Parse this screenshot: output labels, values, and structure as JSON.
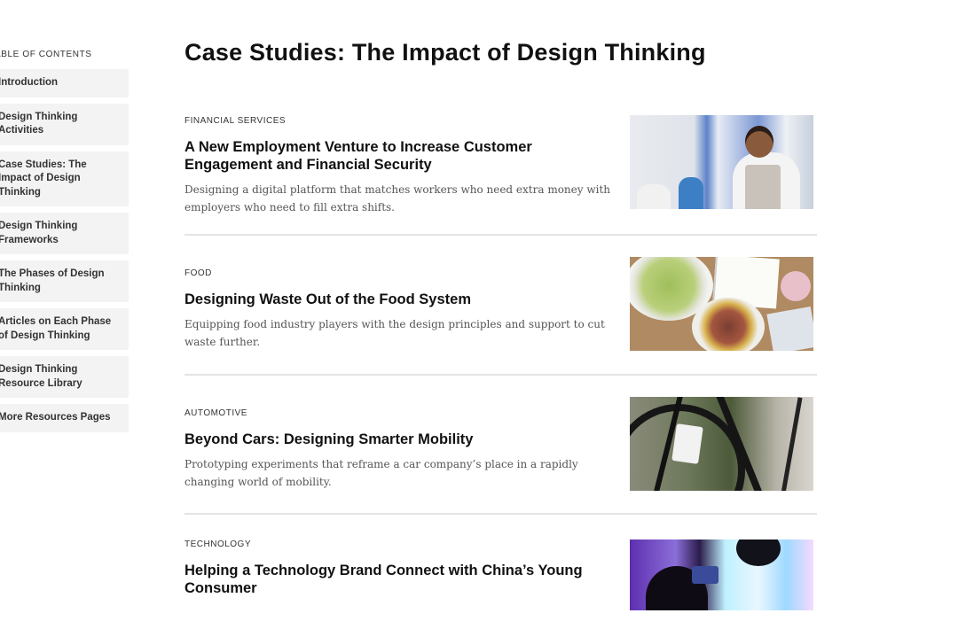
{
  "toc": {
    "heading": "TABLE OF CONTENTS",
    "items": [
      {
        "label": "Introduction"
      },
      {
        "label": "Design Thinking Activities"
      },
      {
        "label": "Case Studies: The Impact of Design Thinking"
      },
      {
        "label": "Design Thinking Frameworks"
      },
      {
        "label": "The Phases of Design Thinking"
      },
      {
        "label": "Articles on Each Phase of Design Thinking"
      },
      {
        "label": "Design Thinking Resource Library"
      },
      {
        "label": "More Resources Pages"
      }
    ]
  },
  "page": {
    "title": "Case Studies: The Impact of Design Thinking"
  },
  "cases": [
    {
      "category": "FINANCIAL SERVICES",
      "title": "A New Employment Venture to Increase Customer Engagement and Financial Security",
      "description": "Designing a digital platform that matches workers who need extra money with employers who need to fill extra shifts.",
      "image": "worker-in-kitchen-photo"
    },
    {
      "category": "FOOD",
      "title": "Designing Waste Out of the Food System",
      "description": "Equipping food industry players with the design principles and support to cut waste further.",
      "image": "food-plates-photo"
    },
    {
      "category": "AUTOMOTIVE",
      "title": "Beyond Cars: Designing Smarter Mobility",
      "description": "Prototyping experiments that reframe a car company’s place in a rapidly changing world of mobility.",
      "image": "bicycle-photo"
    },
    {
      "category": "TECHNOLOGY",
      "title": "Helping a Technology Brand Connect with China’s Young Consumer",
      "description": "",
      "image": "neon-lights-photo"
    }
  ]
}
